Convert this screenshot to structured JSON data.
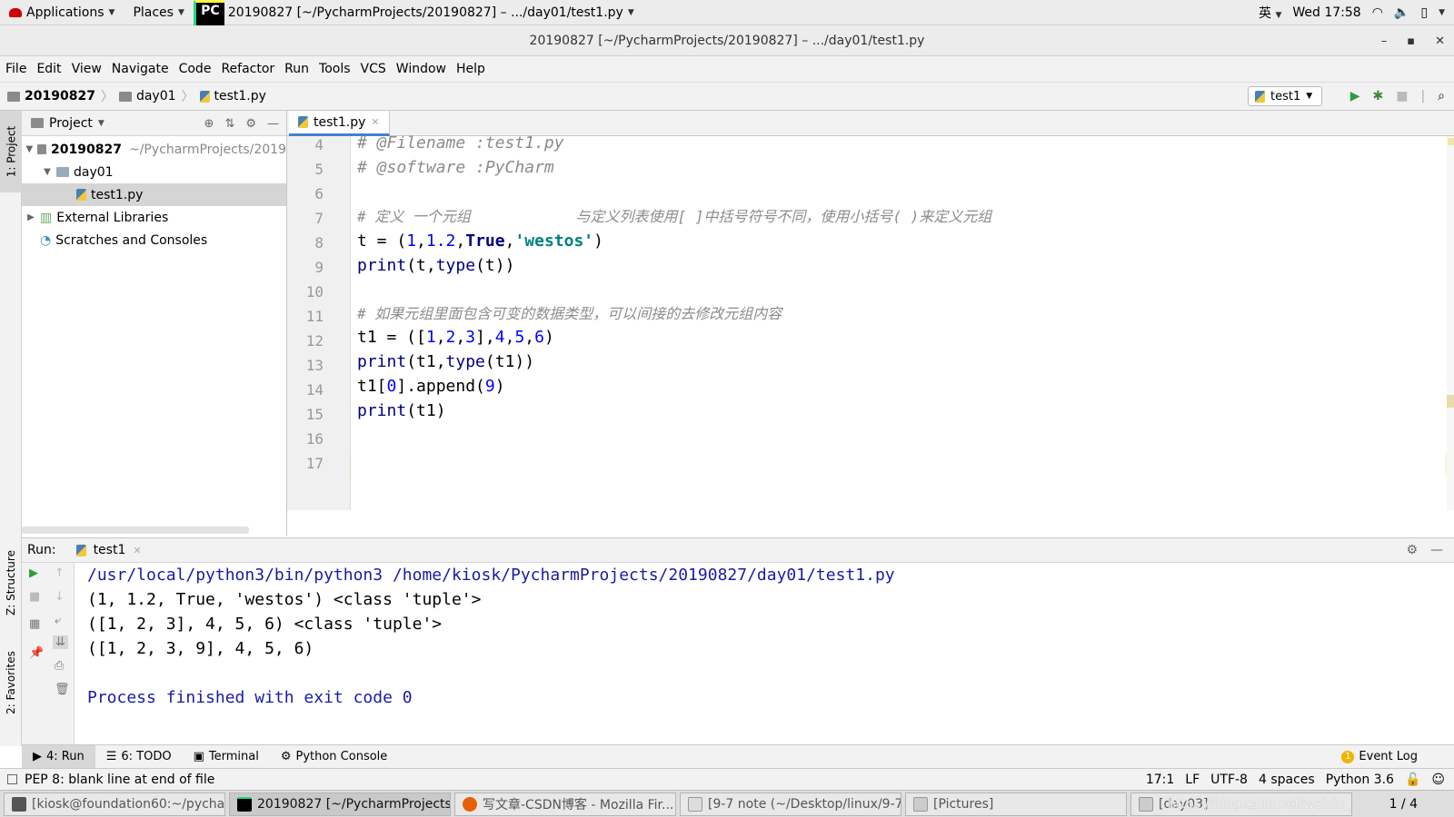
{
  "topbar": {
    "applications": "Applications",
    "places": "Places",
    "window_title": "20190827 [~/PycharmProjects/20190827] – .../day01/test1.py",
    "input_method": "英",
    "clock": "Wed 17:58"
  },
  "titlebar": {
    "title": "20190827 [~/PycharmProjects/20190827] – .../day01/test1.py"
  },
  "menubar": [
    "File",
    "Edit",
    "View",
    "Navigate",
    "Code",
    "Refactor",
    "Run",
    "Tools",
    "VCS",
    "Window",
    "Help"
  ],
  "navbar": {
    "crumbs": [
      "20190827",
      "day01",
      "test1.py"
    ],
    "run_config": "test1"
  },
  "leftstrip": {
    "project": "1: Project",
    "structure": "Z: Structure",
    "favorites": "2: Favorites"
  },
  "project": {
    "header": "Project",
    "root": "20190827",
    "root_path": "~/PycharmProjects/2019",
    "folder": "day01",
    "file": "test1.py",
    "external": "External Libraries",
    "scratches": "Scratches and Consoles"
  },
  "editor": {
    "tab": "test1.py",
    "line_numbers": [
      "4",
      "5",
      "6",
      "7",
      "8",
      "9",
      "10",
      "11",
      "12",
      "13",
      "14",
      "15",
      "16",
      "17"
    ],
    "lines": {
      "l4": "# @Filename :test1.py",
      "l5": "# @software :PyCharm",
      "l7": "# 定义 一个元组            与定义列表使用[ ]中括号符号不同，使用小括号( )来定义元组",
      "l11": "# 如果元组里面包含可变的数据类型，可以间接的去修改元组内容"
    }
  },
  "run": {
    "label": "Run:",
    "config": "test1",
    "output": [
      "/usr/local/python3/bin/python3 /home/kiosk/PycharmProjects/20190827/day01/test1.py",
      "(1, 1.2, True, 'westos') <class 'tuple'>",
      "([1, 2, 3], 4, 5, 6) <class 'tuple'>",
      "([1, 2, 3, 9], 4, 5, 6)",
      "",
      "Process finished with exit code 0"
    ]
  },
  "tooltabs": {
    "run": "4: Run",
    "todo": "6: TODO",
    "terminal": "Terminal",
    "python_console": "Python Console",
    "event_log": "Event Log",
    "event_count": "1"
  },
  "status": {
    "message": "PEP 8: blank line at end of file",
    "position": "17:1",
    "line_sep": "LF",
    "encoding": "UTF-8",
    "indent": "4 spaces",
    "interpreter": "Python 3.6"
  },
  "taskbar": {
    "items": [
      "[kiosk@foundation60:~/pychar...",
      "20190827 [~/PycharmProjects...",
      "写文章-CSDN博客 - Mozilla Fir...",
      "[9-7 note (~/Desktop/linux/9-7...",
      "[Pictures]",
      "[day03]"
    ],
    "pager": "1 / 4",
    "watermark": "https://blog.csdn.net/weixin_42006560"
  },
  "colors": {
    "keyword": "#000080",
    "number": "#0000ff",
    "string": "#008080",
    "comment": "#8c8c8c",
    "console_blue": "#1a1aa6",
    "current_line": "#fcf7dc"
  }
}
